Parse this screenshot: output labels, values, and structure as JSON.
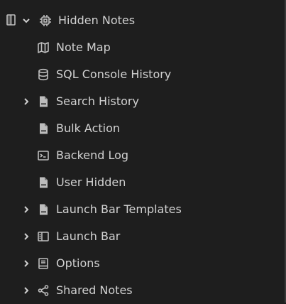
{
  "tree": {
    "root": {
      "label": "Hidden Notes",
      "expanded": true,
      "icon": "chip-icon"
    },
    "items": [
      {
        "label": "Note Map",
        "icon": "map-icon",
        "has_children": false
      },
      {
        "label": "SQL Console History",
        "icon": "database-icon",
        "has_children": false
      },
      {
        "label": "Search History",
        "icon": "file-icon",
        "has_children": true
      },
      {
        "label": "Bulk Action",
        "icon": "file-icon",
        "has_children": false
      },
      {
        "label": "Backend Log",
        "icon": "terminal-icon",
        "has_children": false
      },
      {
        "label": "User Hidden",
        "icon": "file-icon",
        "has_children": false
      },
      {
        "label": "Launch Bar Templates",
        "icon": "file-icon",
        "has_children": true
      },
      {
        "label": "Launch Bar",
        "icon": "sidebar-layout-icon",
        "has_children": true
      },
      {
        "label": "Options",
        "icon": "book-icon",
        "has_children": true
      },
      {
        "label": "Shared Notes",
        "icon": "share-icon",
        "has_children": true
      }
    ]
  },
  "colors": {
    "background": "#1e1e1e",
    "text": "#d2d2d2",
    "icon": "#bdbdbd"
  }
}
